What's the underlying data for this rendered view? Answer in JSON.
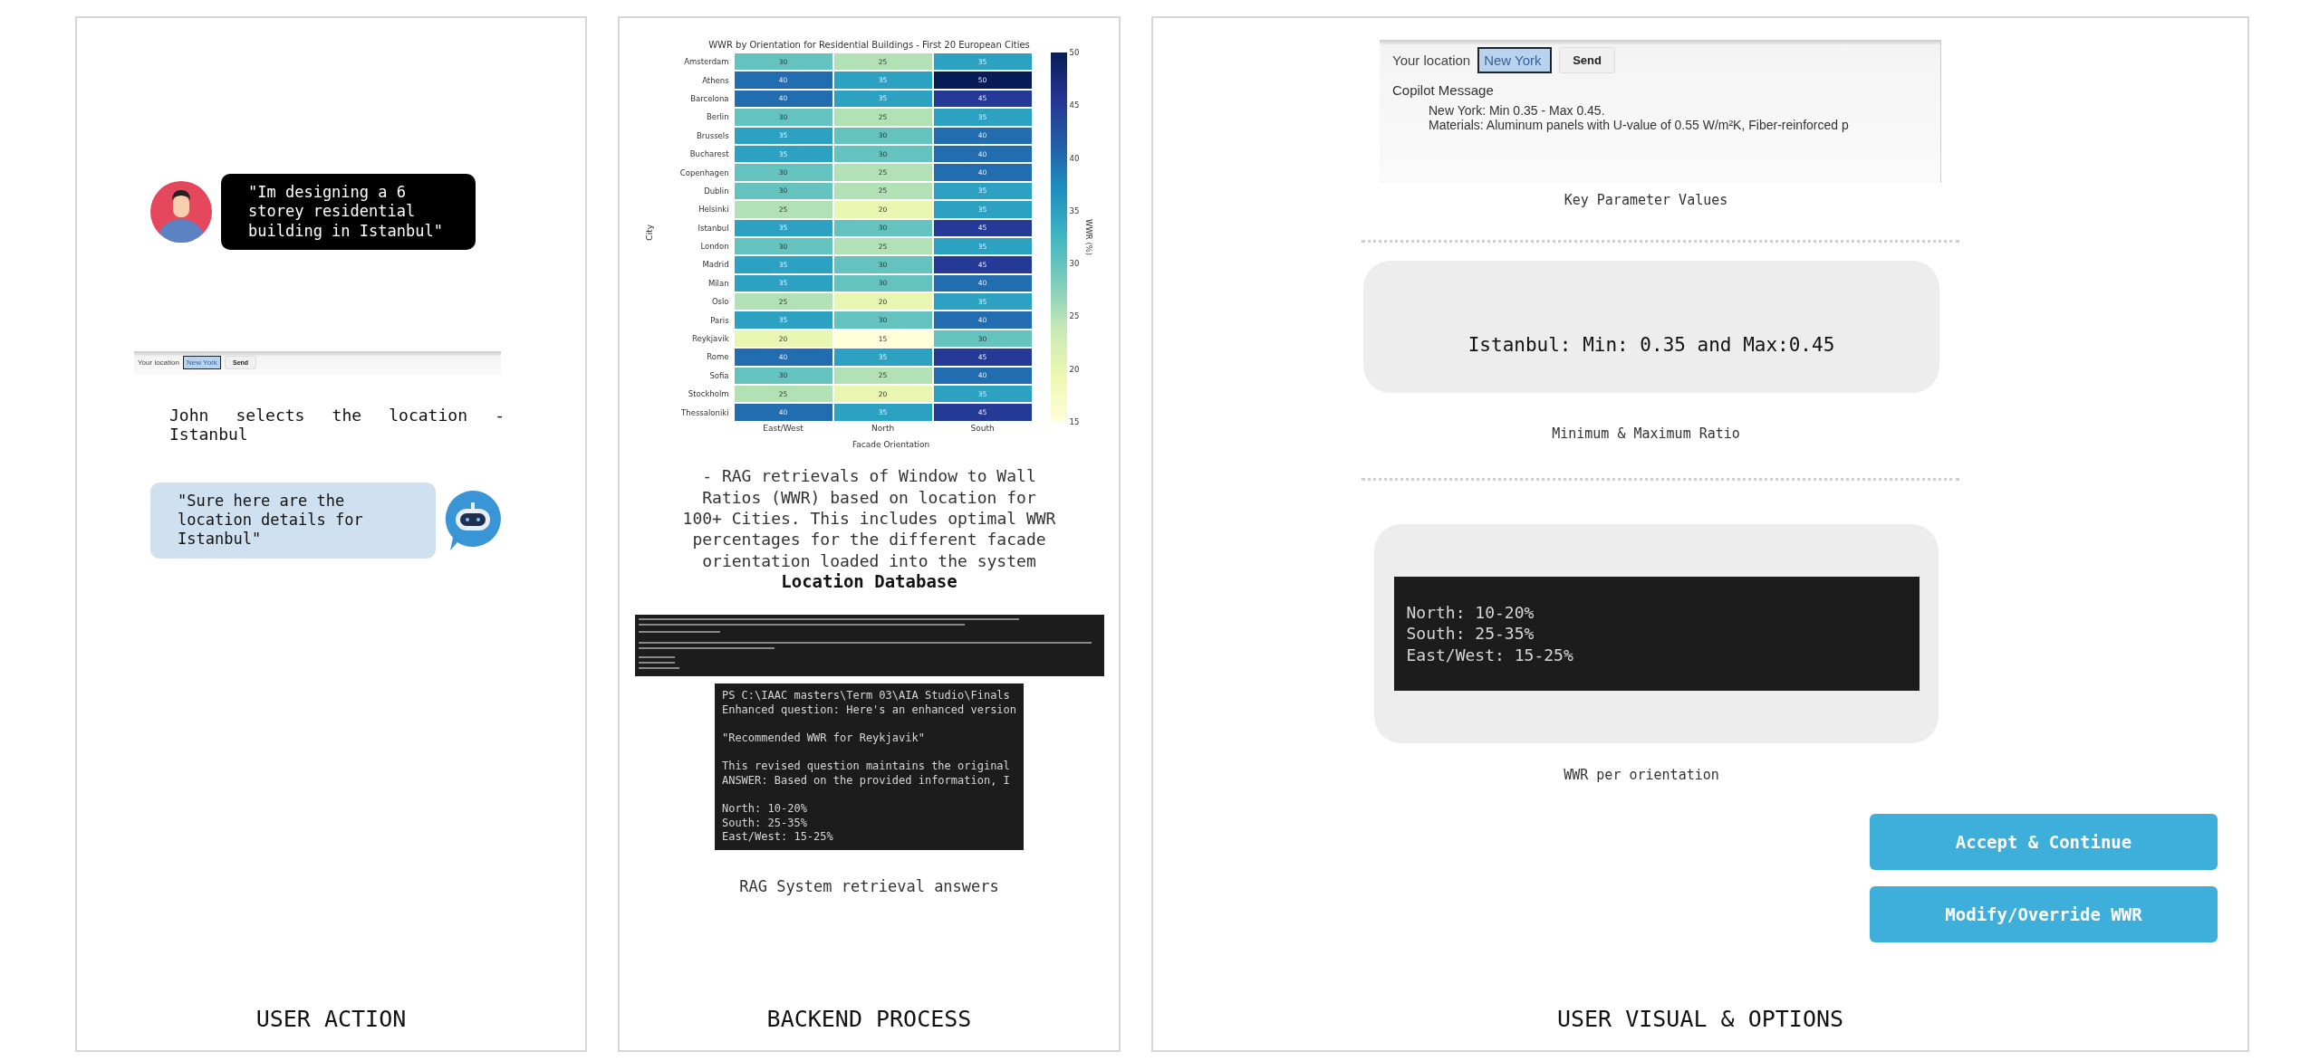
{
  "user_action": {
    "title": "USER ACTION",
    "user_message": "\"Im designing a 6 storey residential building in Istanbul\"",
    "location_widget": {
      "label": "Your location",
      "value": "New York",
      "button": "Send"
    },
    "caption": "John selects the location - Istanbul",
    "bot_message": "\"Sure here are the location details for Istanbul\""
  },
  "backend_process": {
    "title": "BACKEND PROCESS",
    "heatmap": {
      "title": "WWR by Orientation for Residential Buildings - First 20 European Cities",
      "ylabel": "City",
      "xlabel": "Facade Orientation",
      "columns": [
        "East/West",
        "North",
        "South"
      ],
      "colorbar_label": "WWR (%)",
      "colorbar_ticks": [
        "50",
        "45",
        "40",
        "35",
        "30",
        "25",
        "20",
        "15"
      ],
      "rows": [
        {
          "city": "Amsterdam",
          "values": [
            "30",
            "25",
            "35"
          ]
        },
        {
          "city": "Athens",
          "values": [
            "40",
            "35",
            "50"
          ]
        },
        {
          "city": "Barcelona",
          "values": [
            "40",
            "35",
            "45"
          ]
        },
        {
          "city": "Berlin",
          "values": [
            "30",
            "25",
            "35"
          ]
        },
        {
          "city": "Brussels",
          "values": [
            "35",
            "30",
            "40"
          ]
        },
        {
          "city": "Bucharest",
          "values": [
            "35",
            "30",
            "40"
          ]
        },
        {
          "city": "Copenhagen",
          "values": [
            "30",
            "25",
            "40"
          ]
        },
        {
          "city": "Dublin",
          "values": [
            "30",
            "25",
            "35"
          ]
        },
        {
          "city": "Helsinki",
          "values": [
            "25",
            "20",
            "35"
          ]
        },
        {
          "city": "Istanbul",
          "values": [
            "35",
            "30",
            "45"
          ]
        },
        {
          "city": "London",
          "values": [
            "30",
            "25",
            "35"
          ]
        },
        {
          "city": "Madrid",
          "values": [
            "35",
            "30",
            "45"
          ]
        },
        {
          "city": "Milan",
          "values": [
            "35",
            "30",
            "40"
          ]
        },
        {
          "city": "Oslo",
          "values": [
            "25",
            "20",
            "35"
          ]
        },
        {
          "city": "Paris",
          "values": [
            "35",
            "30",
            "40"
          ]
        },
        {
          "city": "Reykjavik",
          "values": [
            "20",
            "15",
            "30"
          ]
        },
        {
          "city": "Rome",
          "values": [
            "40",
            "35",
            "45"
          ]
        },
        {
          "city": "Sofia",
          "values": [
            "30",
            "25",
            "40"
          ]
        },
        {
          "city": "Stockholm",
          "values": [
            "25",
            "20",
            "35"
          ]
        },
        {
          "city": "Thessaloniki",
          "values": [
            "40",
            "35",
            "45"
          ]
        }
      ]
    },
    "description": "- RAG retrievals of Window to Wall Ratios (WWR) based on location for 100+ Cities. This includes optimal WWR percentages for the different facade orientation loaded into the system",
    "heading": "Location Database",
    "terminal_blocks": [
      [
        "PS C:\\IAAC masters\\Term 03\\AIA Studio\\Finals",
        "Enhanced question: Here's an enhanced version"
      ],
      [
        "\"Recommended WWR for Reykjavik\""
      ],
      [
        "This revised question maintains the original",
        "ANSWER: Based on the provided information, I"
      ],
      [
        "North: 10-20%",
        "South: 25-35%",
        "East/West: 15-25%"
      ]
    ],
    "caption": "RAG System retrieval answers"
  },
  "user_visual": {
    "title": "USER VISUAL & OPTIONS",
    "copilot_widget": {
      "label": "Your location",
      "value": "New York",
      "button": "Send",
      "message_title": "Copilot Message",
      "message_lines": [
        "New York: Min 0.35 - Max 0.45.",
        "Materials: Aluminum panels with U-value of 0.55 W/m²K, Fiber-reinforced p"
      ]
    },
    "copilot_caption": "Key Parameter Values",
    "ratio_card": {
      "text": "Istanbul: Min: 0.35 and Max:0.45",
      "caption": "Minimum & Maximum Ratio"
    },
    "orientation_card": {
      "lines": [
        "North: 10-20%",
        "South: 25-35%",
        "East/West: 15-25%"
      ],
      "caption": "WWR per orientation"
    },
    "buttons": [
      "Accept & Continue",
      "Modify/Override WWR"
    ]
  }
}
